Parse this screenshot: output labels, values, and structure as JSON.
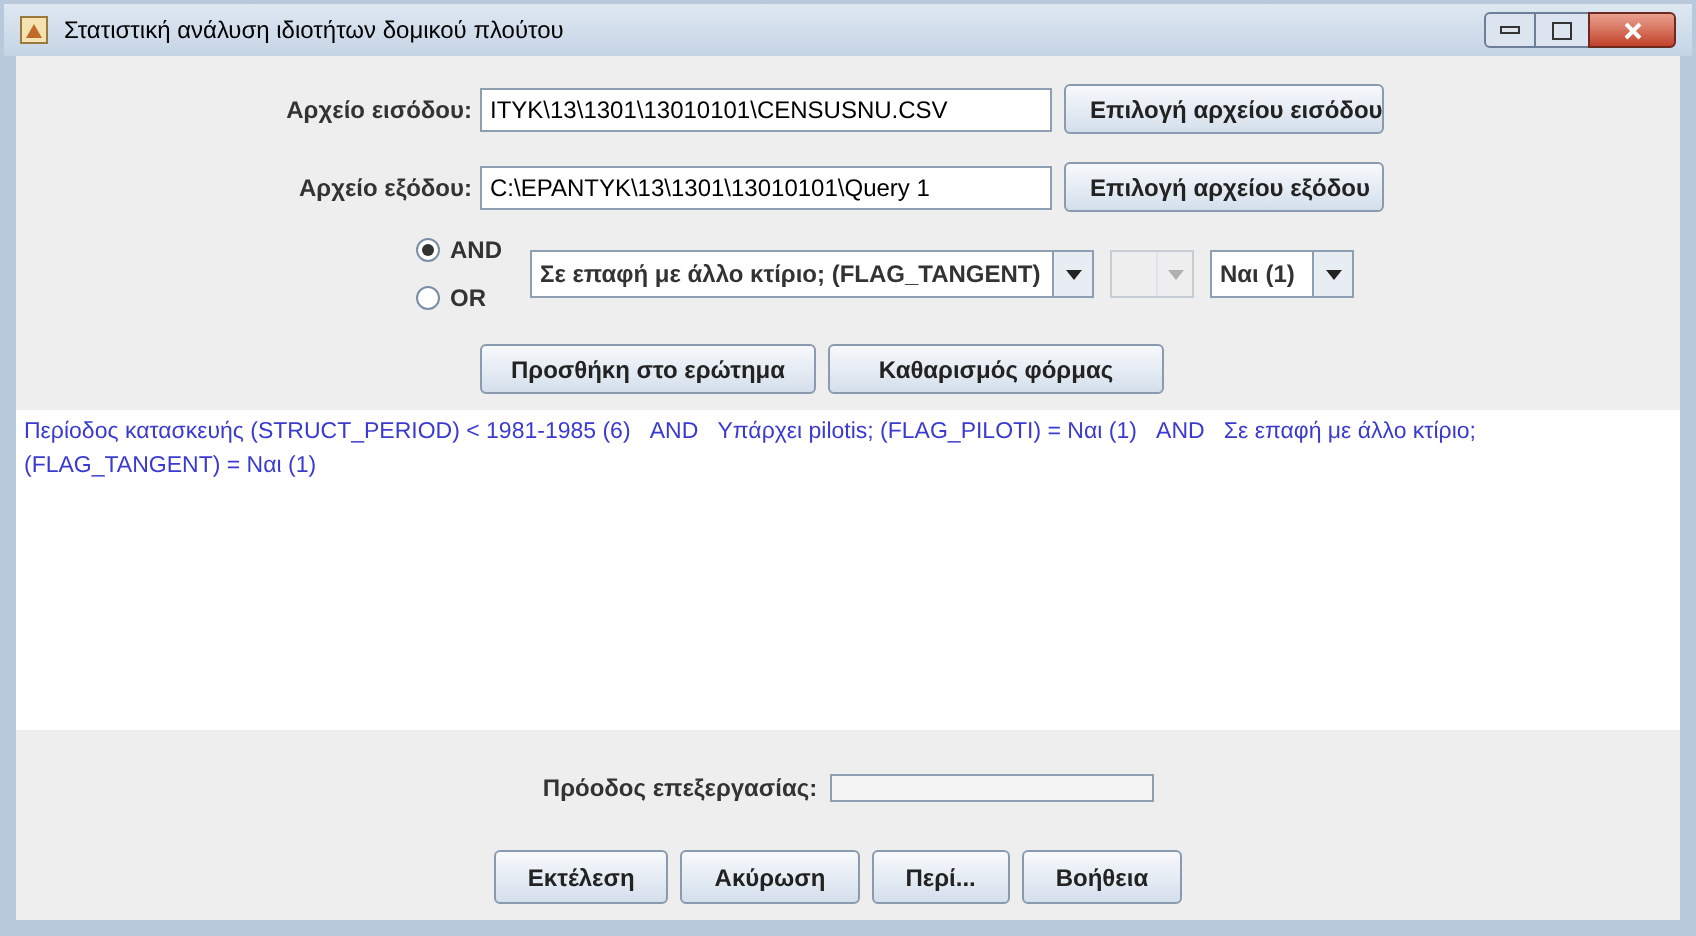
{
  "window": {
    "title": "Στατιστική ανάλυση ιδιοτήτων δομικού πλούτου"
  },
  "files": [
    {
      "label": "Αρχείο εισόδου:",
      "value": "ITYK\\13\\1301\\13010101\\CENSUSNU.CSV",
      "button": "Επιλογή αρχείου εισόδου"
    },
    {
      "label": "Αρχείο εξόδου:",
      "value": "C:\\EPANTYK\\13\\1301\\13010101\\Query 1",
      "button": "Επιλογή αρχείου εξόδου"
    }
  ],
  "operators": [
    {
      "label": "AND",
      "selected": true
    },
    {
      "label": "OR",
      "selected": false
    }
  ],
  "field_combo": {
    "value": "Σε επαφή με άλλο κτίριο; (FLAG_TANGENT)"
  },
  "operator_combo": {
    "disabled": true
  },
  "value_combo": {
    "value": "Ναι (1)"
  },
  "form_buttons": [
    "Προσθήκη στο ερώτημα",
    "Καθαρισμός φόρμας"
  ],
  "query_text": "Περίοδος κατασκευής (STRUCT_PERIOD) < 1981-1985 (6)   AND   Υπάρχει pilotis; (FLAG_PILOTI) = Ναι (1)   AND   Σε επαφή με άλλο κτίριο; (FLAG_TANGENT) = Ναι (1)",
  "progress": {
    "label": "Πρόοδος επεξεργασίας:",
    "level": 0
  },
  "buttons": [
    "Εκτέλεση",
    "Ακύρωση",
    "Περί...",
    "Βοήθεια"
  ]
}
